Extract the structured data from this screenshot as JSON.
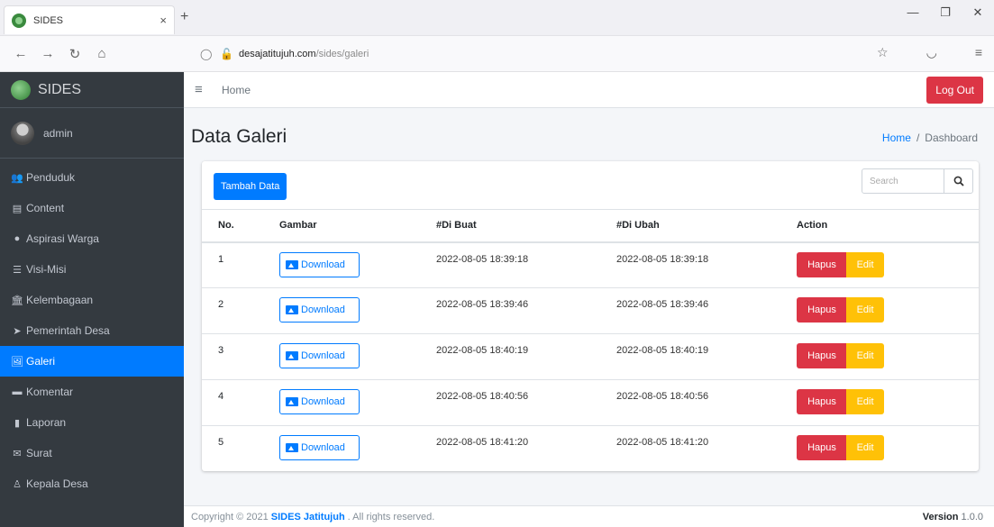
{
  "browser": {
    "tab_title": "SIDES",
    "tab_close": "×",
    "new_tab": "+",
    "url_host": "desajatitujuh.com",
    "url_path": "/sides/galeri",
    "win_minimize": "—",
    "win_maximize": "❐",
    "win_close": "✕"
  },
  "sidebar": {
    "brand": "SIDES",
    "user": "admin",
    "items": [
      {
        "label": "Penduduk",
        "icon": "users-icon",
        "glyph": "👥"
      },
      {
        "label": "Content",
        "icon": "newspaper-icon",
        "glyph": "▤"
      },
      {
        "label": "Aspirasi Warga",
        "icon": "location-pin-icon",
        "glyph": "●"
      },
      {
        "label": "Visi-Misi",
        "icon": "list-icon",
        "glyph": "☰"
      },
      {
        "label": "Kelembagaan",
        "icon": "institution-icon",
        "glyph": "🏛"
      },
      {
        "label": "Pemerintah Desa",
        "icon": "paper-plane-icon",
        "glyph": "➤"
      },
      {
        "label": "Galeri",
        "icon": "images-icon",
        "glyph": "🖼"
      },
      {
        "label": "Komentar",
        "icon": "comment-icon",
        "glyph": "▬"
      },
      {
        "label": "Laporan",
        "icon": "file-icon",
        "glyph": "▮"
      },
      {
        "label": "Surat",
        "icon": "envelope-icon",
        "glyph": "✉"
      },
      {
        "label": "Kepala Desa",
        "icon": "user-icon",
        "glyph": "♙"
      }
    ],
    "active_index": 6
  },
  "topbar": {
    "home": "Home",
    "logout": "Log Out"
  },
  "page": {
    "title": "Data Galeri",
    "breadcrumb_home": "Home",
    "breadcrumb_sep": "/",
    "breadcrumb_current": "Dashboard"
  },
  "card": {
    "add_button": "Tambah Data",
    "search_placeholder": "Search",
    "columns": [
      "No.",
      "Gambar",
      "#Di Buat",
      "#Di Ubah",
      "Action"
    ],
    "rows": [
      {
        "no": "1",
        "download": "Download",
        "created": "2022-08-05 18:39:18",
        "updated": "2022-08-05 18:39:18",
        "delete": "Hapus",
        "edit": "Edit"
      },
      {
        "no": "2",
        "download": "Download",
        "created": "2022-08-05 18:39:46",
        "updated": "2022-08-05 18:39:46",
        "delete": "Hapus",
        "edit": "Edit"
      },
      {
        "no": "3",
        "download": "Download",
        "created": "2022-08-05 18:40:19",
        "updated": "2022-08-05 18:40:19",
        "delete": "Hapus",
        "edit": "Edit"
      },
      {
        "no": "4",
        "download": "Download",
        "created": "2022-08-05 18:40:56",
        "updated": "2022-08-05 18:40:56",
        "delete": "Hapus",
        "edit": "Edit"
      },
      {
        "no": "5",
        "download": "Download",
        "created": "2022-08-05 18:41:20",
        "updated": "2022-08-05 18:41:20",
        "delete": "Hapus",
        "edit": "Edit"
      }
    ]
  },
  "footer": {
    "prefix": "Copyright © 2021",
    "brand": "SIDES Jatitujuh",
    "suffix": ". All rights reserved.",
    "version_label": "Version",
    "version": "1.0.0"
  },
  "colors": {
    "primary": "#007bff",
    "danger": "#dc3545",
    "warning": "#ffc107",
    "sidebar": "#343a40"
  }
}
